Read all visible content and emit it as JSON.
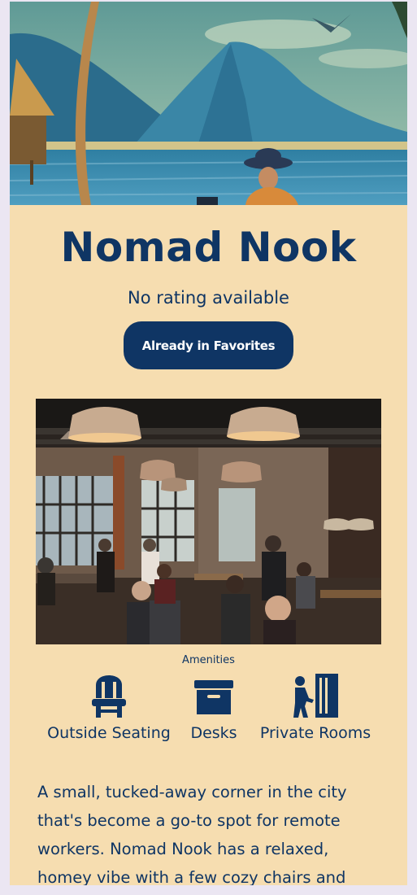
{
  "cafe": {
    "name": "Nomad Nook",
    "rating_text": "No rating available",
    "favorite_button_label": "Already in Favorites",
    "description": "A small, tucked-away corner in the city that's become a go-to spot for remote workers. Nomad Nook has a relaxed, homey vibe with a few cozy chairs and"
  },
  "amenities": {
    "heading": "Amenities",
    "items": [
      {
        "label": "Outside Seating",
        "icon": "chair-icon"
      },
      {
        "label": "Desks",
        "icon": "archive-box-icon"
      },
      {
        "label": "Private Rooms",
        "icon": "person-door-icon"
      }
    ]
  },
  "colors": {
    "page_background": "#ebe6f2",
    "card_background": "#f6ddb0",
    "primary": "#0f3564",
    "button_text": "#ffffff"
  }
}
